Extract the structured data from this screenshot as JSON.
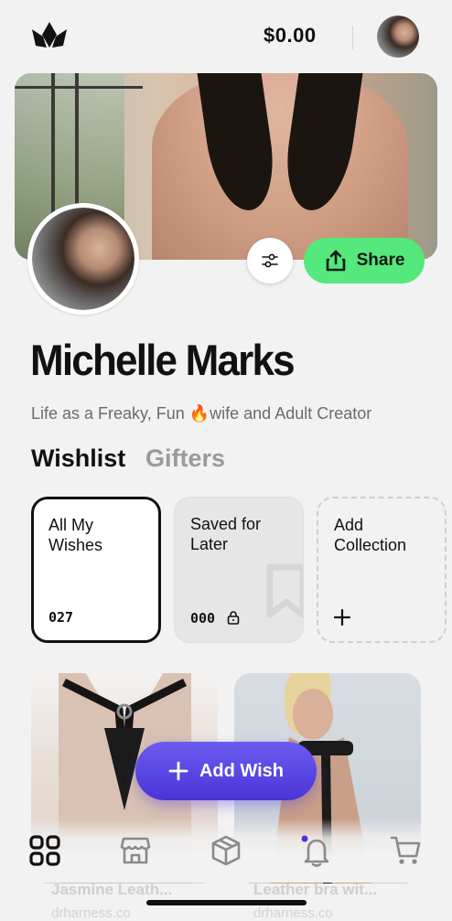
{
  "header": {
    "balance": "$0.00"
  },
  "profile": {
    "name": "Michelle Marks",
    "bio": "Life as a Freaky, Fun 🔥wife and Adult Creator",
    "share_label": "Share"
  },
  "tabs": [
    {
      "label": "Wishlist",
      "active": true
    },
    {
      "label": "Gifters",
      "active": false
    }
  ],
  "collections": [
    {
      "title": "All My Wishes",
      "count": "027",
      "selected": true
    },
    {
      "title": "Saved for Later",
      "count": "000"
    },
    {
      "title": "Add Collection"
    }
  ],
  "products": [
    {
      "name": "Jasmine Leath...",
      "vendor": "drharness.co"
    },
    {
      "name": "Leather bra wit...",
      "vendor": "drharness.co"
    }
  ],
  "add_wish_label": "Add Wish",
  "colors": {
    "share_green": "#55e87c",
    "add_wish_purple": "#5a48e6",
    "notification_dot": "#4a34d8"
  },
  "nav_icons": [
    "grid-icon",
    "shop-icon",
    "box-icon",
    "bell-icon",
    "cart-icon"
  ]
}
